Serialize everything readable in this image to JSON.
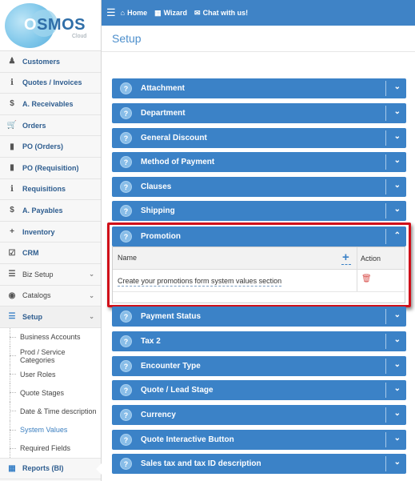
{
  "logo": {
    "text_first": "O",
    "text_rest": "SMOS",
    "sub": "Cloud"
  },
  "topbar": {
    "menu_icon": "hamburger-icon",
    "links": [
      {
        "icon": "home-icon",
        "label": "Home"
      },
      {
        "icon": "wizard-icon",
        "label": "Wizard"
      },
      {
        "icon": "chat-icon",
        "label": "Chat with us!"
      }
    ]
  },
  "sidebar": {
    "items": [
      {
        "icon": "user-icon",
        "label": "Customers"
      },
      {
        "icon": "info-icon",
        "label": "Quotes / Invoices"
      },
      {
        "icon": "dollar-icon",
        "label": "A. Receivables"
      },
      {
        "icon": "cart-icon",
        "label": "Orders"
      },
      {
        "icon": "document-icon",
        "label": "PO (Orders)"
      },
      {
        "icon": "document-icon",
        "label": "PO (Requisition)"
      },
      {
        "icon": "info-icon",
        "label": "Requisitions"
      },
      {
        "icon": "dollar-icon",
        "label": "A. Payables"
      },
      {
        "icon": "plus-icon",
        "label": "Inventory"
      },
      {
        "icon": "check-icon",
        "label": "CRM"
      },
      {
        "icon": "list-icon",
        "label": "Biz Setup"
      },
      {
        "icon": "palette-icon",
        "label": "Catalogs"
      },
      {
        "icon": "list-icon",
        "label": "Setup"
      }
    ],
    "setup_sub": [
      "Business Accounts",
      "Prod / Service Categories",
      "User Roles",
      "Quote Stages",
      "Date & Time description",
      "System Values",
      "Required Fields"
    ],
    "reports": {
      "icon": "chart-icon",
      "label": "Reports (BI)"
    }
  },
  "page": {
    "title": "Setup"
  },
  "panels": {
    "attachment": "Attachment",
    "department": "Department",
    "general_discount": "General Discount",
    "method_of_payment": "Method of Payment",
    "clauses": "Clauses",
    "shipping": "Shipping",
    "promotion": "Promotion",
    "payment_status": "Payment Status",
    "tax2": "Tax 2",
    "encounter_type": "Encounter Type",
    "quote_lead_stage": "Quote / Lead Stage",
    "currency": "Currency",
    "quote_interactive_button": "Quote Interactive Button",
    "sales_tax": "Sales tax and tax ID description"
  },
  "promotion_table": {
    "col_name": "Name",
    "col_action": "Action",
    "row_text": "Create your promotions form system values section"
  },
  "colors": {
    "accent": "#3b82c7",
    "topbar": "#3f83c6",
    "highlight": "#d0101a",
    "delete": "#d9534f"
  }
}
